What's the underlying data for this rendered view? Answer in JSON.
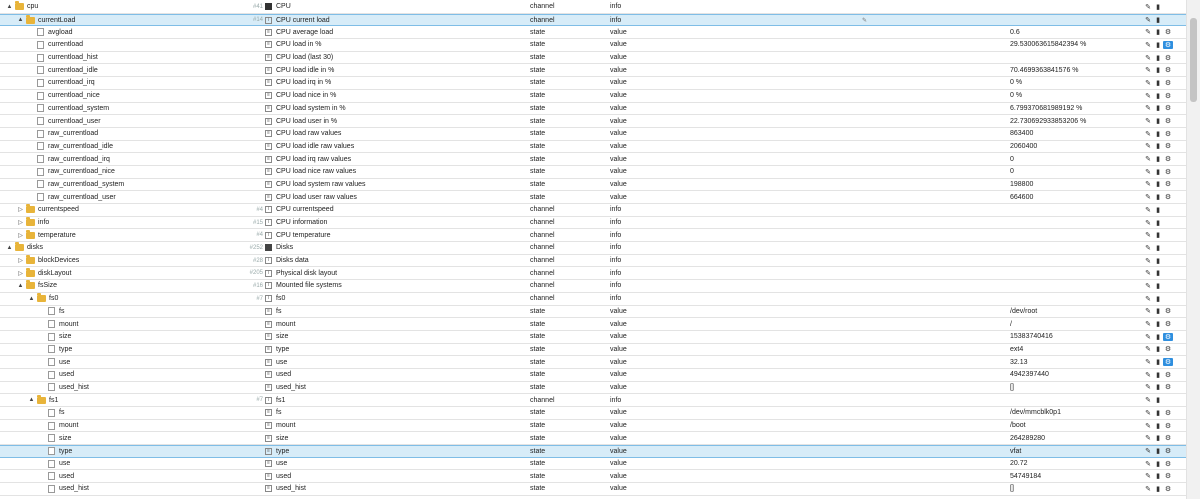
{
  "rows": [
    {
      "id": "cpu",
      "level": 0,
      "tog": "▲",
      "icon": "folder",
      "num": "#41",
      "name": "CPU",
      "nicon": "cpu",
      "type": "channel",
      "role": "info",
      "value": "",
      "w": false
    },
    {
      "id": "currentLoad",
      "level": 1,
      "tog": "▲",
      "icon": "folder",
      "num": "#14",
      "name": "CPU current load",
      "nicon": "i",
      "type": "channel",
      "role": "info",
      "value": "",
      "w": false,
      "hl": true,
      "pen": true
    },
    {
      "id": "avgload",
      "level": 2,
      "icon": "file",
      "name": "CPU average load",
      "nicon": "f",
      "type": "state",
      "role": "value",
      "value": "0.6",
      "w": true
    },
    {
      "id": "currentload",
      "level": 2,
      "icon": "file",
      "name": "CPU load in %",
      "nicon": "f",
      "type": "state",
      "role": "value",
      "value": "29.530063615842394 %",
      "w": true,
      "won": true
    },
    {
      "id": "currentload_hist",
      "level": 2,
      "icon": "file",
      "name": "CPU load (last 30)",
      "nicon": "f",
      "type": "state",
      "role": "value",
      "value": "",
      "w": true
    },
    {
      "id": "currentload_idle",
      "level": 2,
      "icon": "file",
      "name": "CPU load idle in %",
      "nicon": "f",
      "type": "state",
      "role": "value",
      "value": "70.4699363841576 %",
      "w": true
    },
    {
      "id": "currentload_irq",
      "level": 2,
      "icon": "file",
      "name": "CPU load irq in %",
      "nicon": "f",
      "type": "state",
      "role": "value",
      "value": "0 %",
      "w": true
    },
    {
      "id": "currentload_nice",
      "level": 2,
      "icon": "file",
      "name": "CPU load nice in %",
      "nicon": "f",
      "type": "state",
      "role": "value",
      "value": "0 %",
      "w": true
    },
    {
      "id": "currentload_system",
      "level": 2,
      "icon": "file",
      "name": "CPU load system in %",
      "nicon": "f",
      "type": "state",
      "role": "value",
      "value": "6.799370681989192 %",
      "w": true
    },
    {
      "id": "currentload_user",
      "level": 2,
      "icon": "file",
      "name": "CPU load user in %",
      "nicon": "f",
      "type": "state",
      "role": "value",
      "value": "22.730692933853206 %",
      "w": true
    },
    {
      "id": "raw_currentload",
      "level": 2,
      "icon": "file",
      "name": "CPU load raw values",
      "nicon": "f",
      "type": "state",
      "role": "value",
      "value": "863400",
      "w": true
    },
    {
      "id": "raw_currentload_idle",
      "level": 2,
      "icon": "file",
      "name": "CPU load idle raw values",
      "nicon": "f",
      "type": "state",
      "role": "value",
      "value": "2060400",
      "w": true
    },
    {
      "id": "raw_currentload_irq",
      "level": 2,
      "icon": "file",
      "name": "CPU load irq raw values",
      "nicon": "f",
      "type": "state",
      "role": "value",
      "value": "0",
      "w": true
    },
    {
      "id": "raw_currentload_nice",
      "level": 2,
      "icon": "file",
      "name": "CPU load nice raw values",
      "nicon": "f",
      "type": "state",
      "role": "value",
      "value": "0",
      "w": true
    },
    {
      "id": "raw_currentload_system",
      "level": 2,
      "icon": "file",
      "name": "CPU load system raw values",
      "nicon": "f",
      "type": "state",
      "role": "value",
      "value": "198800",
      "w": true
    },
    {
      "id": "raw_currentload_user",
      "level": 2,
      "icon": "file",
      "name": "CPU load user raw values",
      "nicon": "f",
      "type": "state",
      "role": "value",
      "value": "664600",
      "w": true
    },
    {
      "id": "currentspeed",
      "level": 1,
      "tog": "▷",
      "icon": "folder",
      "num": "#4",
      "name": "CPU currentspeed",
      "nicon": "i",
      "type": "channel",
      "role": "info",
      "value": "",
      "w": false
    },
    {
      "id": "info",
      "level": 1,
      "tog": "▷",
      "icon": "folder",
      "num": "#15",
      "name": "CPU information",
      "nicon": "i",
      "type": "channel",
      "role": "info",
      "value": "",
      "w": false
    },
    {
      "id": "temperature",
      "level": 1,
      "tog": "▷",
      "icon": "folder",
      "num": "#4",
      "name": "CPU temperature",
      "nicon": "i",
      "type": "channel",
      "role": "info",
      "value": "",
      "w": false
    },
    {
      "id": "disks",
      "level": 0,
      "tog": "▲",
      "icon": "folder",
      "num": "#252",
      "name": "Disks",
      "nicon": "disk",
      "type": "channel",
      "role": "info",
      "value": "",
      "w": false
    },
    {
      "id": "blockDevices",
      "level": 1,
      "tog": "▷",
      "icon": "folder",
      "num": "#28",
      "name": "Disks data",
      "nicon": "i",
      "type": "channel",
      "role": "info",
      "value": "",
      "w": false
    },
    {
      "id": "diskLayout",
      "level": 1,
      "tog": "▷",
      "icon": "folder",
      "num": "#205",
      "name": "Physical disk layout",
      "nicon": "i",
      "type": "channel",
      "role": "info",
      "value": "",
      "w": false
    },
    {
      "id": "fsSize",
      "level": 1,
      "tog": "▲",
      "icon": "folder",
      "num": "#16",
      "name": "Mounted file systems",
      "nicon": "i",
      "type": "channel",
      "role": "info",
      "value": "",
      "w": false
    },
    {
      "id": "fs0",
      "level": 2,
      "tog": "▲",
      "icon": "folder",
      "num": "#7",
      "name": "fs0",
      "nicon": "i",
      "type": "channel",
      "role": "info",
      "value": "",
      "w": false
    },
    {
      "id": "fs",
      "level": 3,
      "icon": "file",
      "name": "fs",
      "nicon": "f",
      "type": "state",
      "role": "value",
      "value": "/dev/root",
      "w": true
    },
    {
      "id": "mount",
      "level": 3,
      "icon": "file",
      "name": "mount",
      "nicon": "f",
      "type": "state",
      "role": "value",
      "value": "/",
      "w": true
    },
    {
      "id": "size",
      "level": 3,
      "icon": "file",
      "name": "size",
      "nicon": "f",
      "type": "state",
      "role": "value",
      "value": "15383740416",
      "w": true,
      "won": true
    },
    {
      "id": "type",
      "level": 3,
      "icon": "file",
      "name": "type",
      "nicon": "f",
      "type": "state",
      "role": "value",
      "value": "ext4",
      "w": true
    },
    {
      "id": "use",
      "level": 3,
      "icon": "file",
      "name": "use",
      "nicon": "f",
      "type": "state",
      "role": "value",
      "value": "32.13",
      "w": true,
      "won": true
    },
    {
      "id": "used",
      "level": 3,
      "icon": "file",
      "name": "used",
      "nicon": "f",
      "type": "state",
      "role": "value",
      "value": "4942397440",
      "w": true
    },
    {
      "id": "used_hist",
      "level": 3,
      "icon": "file",
      "name": "used_hist",
      "nicon": "f",
      "type": "state",
      "role": "value",
      "value": "[]",
      "w": true
    },
    {
      "id": "fs1",
      "level": 2,
      "tog": "▲",
      "icon": "folder",
      "num": "#7",
      "name": "fs1",
      "nicon": "i",
      "type": "channel",
      "role": "info",
      "value": "",
      "w": false
    },
    {
      "id": "fs",
      "level": 3,
      "icon": "file",
      "name": "fs",
      "nicon": "f",
      "type": "state",
      "role": "value",
      "value": "/dev/mmcblk0p1",
      "w": true
    },
    {
      "id": "mount",
      "level": 3,
      "icon": "file",
      "name": "mount",
      "nicon": "f",
      "type": "state",
      "role": "value",
      "value": "/boot",
      "w": true
    },
    {
      "id": "size",
      "level": 3,
      "icon": "file",
      "name": "size",
      "nicon": "f",
      "type": "state",
      "role": "value",
      "value": "264289280",
      "w": true
    },
    {
      "id": "type",
      "level": 3,
      "icon": "file",
      "name": "type",
      "nicon": "f",
      "type": "state",
      "role": "value",
      "value": "vfat",
      "w": true,
      "hl": true
    },
    {
      "id": "use",
      "level": 3,
      "icon": "file",
      "name": "use",
      "nicon": "f",
      "type": "state",
      "role": "value",
      "value": "20.72",
      "w": true
    },
    {
      "id": "used",
      "level": 3,
      "icon": "file",
      "name": "used",
      "nicon": "f",
      "type": "state",
      "role": "value",
      "value": "54749184",
      "w": true
    },
    {
      "id": "used_hist",
      "level": 3,
      "icon": "file",
      "name": "used_hist",
      "nicon": "f",
      "type": "state",
      "role": "value",
      "value": "[]",
      "w": true
    }
  ],
  "icons": {
    "edit": "pencil-icon",
    "delete": "trash-icon",
    "settings": "wrench-icon"
  },
  "colors": {
    "highlight": "#d7ecf8",
    "folder": "#e8b43a",
    "wrench_active": "#2f8fdf"
  }
}
